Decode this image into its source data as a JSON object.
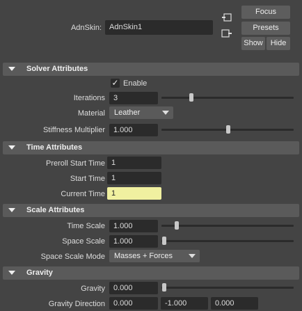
{
  "node": {
    "label": "AdnSkin:",
    "value": "AdnSkin1"
  },
  "buttons": {
    "focus": "Focus",
    "presets": "Presets",
    "show": "Show",
    "hide": "Hide"
  },
  "solver": {
    "title": "Solver Attributes",
    "enable_label": "Enable",
    "enable_checked": true,
    "iterations_label": "Iterations",
    "iterations_value": "3",
    "iterations_slider": 0.26,
    "material_label": "Material",
    "material_value": "Leather",
    "stiffness_label": "Stiffness Multiplier",
    "stiffness_value": "1.000",
    "stiffness_slider": 0.53
  },
  "time": {
    "title": "Time Attributes",
    "preroll_label": "Preroll Start Time",
    "preroll_value": "1",
    "start_label": "Start Time",
    "start_value": "1",
    "current_label": "Current Time",
    "current_value": "1"
  },
  "scale": {
    "title": "Scale Attributes",
    "time_scale_label": "Time Scale",
    "time_scale_value": "1.000",
    "time_scale_slider": 0.1,
    "space_scale_label": "Space Scale",
    "space_scale_value": "1.000",
    "space_scale_slider": 0.0,
    "mode_label": "Space Scale Mode",
    "mode_value": "Masses + Forces"
  },
  "gravity": {
    "title": "Gravity",
    "gravity_label": "Gravity",
    "gravity_value": "0.000",
    "gravity_slider": 0.0,
    "direction_label": "Gravity Direction",
    "direction_x": "0.000",
    "direction_y": "-1.000",
    "direction_z": "0.000"
  }
}
